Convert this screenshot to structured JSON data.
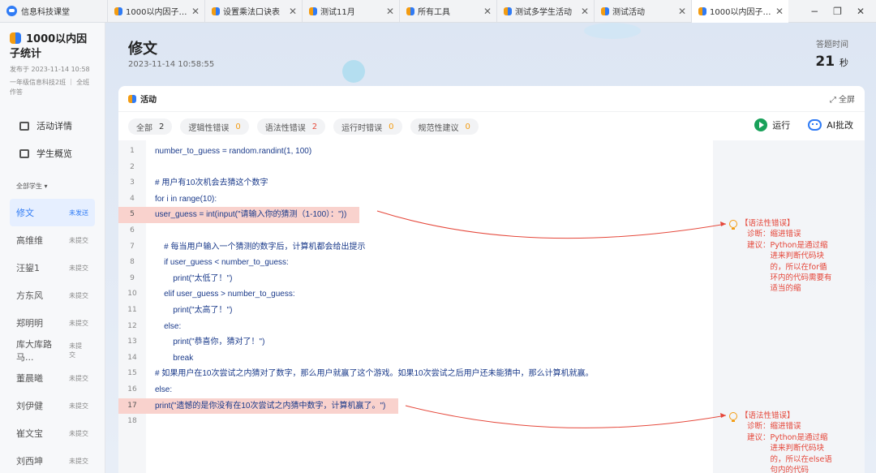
{
  "app": {
    "title": "信息科技课堂"
  },
  "tabs": [
    {
      "label": "1000以内因子统...",
      "active": false
    },
    {
      "label": "设置乘法口诀表",
      "active": false
    },
    {
      "label": "测试11月",
      "active": false
    },
    {
      "label": "所有工具",
      "active": false
    },
    {
      "label": "测试多学生活动",
      "active": false
    },
    {
      "label": "测试活动",
      "active": false
    },
    {
      "label": "1000以内因子统...",
      "active": true
    }
  ],
  "window": {
    "minimize": "−",
    "restore": "❐",
    "close": "✕"
  },
  "sidebar": {
    "title": "1000以内因子统计",
    "published": "发布于 2023-11-14 10:58",
    "class_info": "一年级信息科技2班 ｜ 全班作答",
    "nav": [
      {
        "label": "活动详情"
      },
      {
        "label": "学生概览"
      }
    ],
    "filter": "全部学生 ▾",
    "students": [
      {
        "name": "修文",
        "status": "未发送",
        "active": true
      },
      {
        "name": "高维维",
        "status": "未提交"
      },
      {
        "name": "汪鋆1",
        "status": "未提交"
      },
      {
        "name": "方东风",
        "status": "未提交"
      },
      {
        "name": "郑明明",
        "status": "未提交"
      },
      {
        "name": "库大库路马...",
        "status": "未提交"
      },
      {
        "name": "董晨曦",
        "status": "未提交"
      },
      {
        "name": "刘伊健",
        "status": "未提交"
      },
      {
        "name": "崔文宝",
        "status": "未提交"
      },
      {
        "name": "刘西坤",
        "status": "未提交"
      }
    ]
  },
  "header": {
    "student": "修文",
    "time": "2023-11-14 10:58:55",
    "answer_label": "答题时间",
    "answer_value": "21",
    "answer_unit": "秒"
  },
  "card": {
    "title": "活动",
    "fullscreen": "⤢ 全屏",
    "filters": [
      {
        "label": "全部",
        "count": "2"
      },
      {
        "label": "逻辑性错误",
        "count": "0"
      },
      {
        "label": "语法性错误",
        "count": "2"
      },
      {
        "label": "运行时错误",
        "count": "0"
      },
      {
        "label": "规范性建议",
        "count": "0"
      }
    ],
    "run": "运行",
    "ai": "AI批改"
  },
  "code_lines": [
    {
      "n": "1",
      "text": "number_to_guess = random.randint(1, 100)"
    },
    {
      "n": "2",
      "text": ""
    },
    {
      "n": "3",
      "text": "# 用户有10次机会去猜这个数字"
    },
    {
      "n": "4",
      "text": "for i in range(10):"
    },
    {
      "n": "5",
      "text": "user_guess = int(input(\"请输入你的猜测（1-100）：\"))",
      "error": true
    },
    {
      "n": "6",
      "text": ""
    },
    {
      "n": "7",
      "text": "    # 每当用户输入一个猜测的数字后，计算机都会给出提示"
    },
    {
      "n": "8",
      "text": "    if user_guess < number_to_guess:"
    },
    {
      "n": "9",
      "text": "        print(\"太低了！\")"
    },
    {
      "n": "10",
      "text": "    elif user_guess > number_to_guess:"
    },
    {
      "n": "11",
      "text": "        print(\"太高了！\")"
    },
    {
      "n": "12",
      "text": "    else:"
    },
    {
      "n": "13",
      "text": "        print(\"恭喜你，猜对了！\")"
    },
    {
      "n": "14",
      "text": "        break"
    },
    {
      "n": "15",
      "text": "# 如果用户在10次尝试之内猜对了数字，那么用户就赢了这个游戏。如果10次尝试之后用户还未能猜中，那么计算机就赢。"
    },
    {
      "n": "16",
      "text": "else:"
    },
    {
      "n": "17",
      "text": "print(\"遗憾的是你没有在10次尝试之内猜中数字，计算机赢了。\")",
      "error": true
    },
    {
      "n": "18",
      "text": ""
    }
  ],
  "diagnostics": [
    {
      "type": "【语法性错误】",
      "diagnosis_label": "诊断：",
      "diagnosis": "缩进错误",
      "suggestion_label": "建议：",
      "suggestion": "Python是通过缩进来判断代码块的，所以在for循环内的代码需要有适当的缩"
    },
    {
      "type": "【语法性错误】",
      "diagnosis_label": "诊断：",
      "diagnosis": "缩进错误",
      "suggestion_label": "建议：",
      "suggestion": "Python是通过缩进来判断代码块的，所以在else语句内的代码"
    }
  ],
  "colors": {
    "accent": "#2f7bf5",
    "error": "#e5473a",
    "error_bg": "#f9d2cd",
    "run": "#19a15a"
  }
}
